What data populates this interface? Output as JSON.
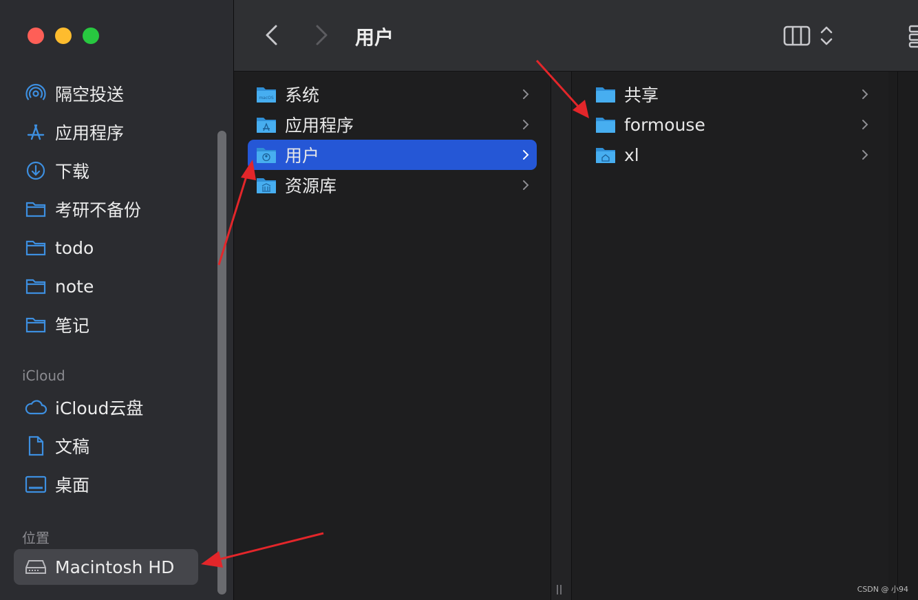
{
  "sidebar": {
    "favorites": [
      {
        "label": "隔空投送",
        "icon": "airdrop-icon"
      },
      {
        "label": "应用程序",
        "icon": "applications-icon"
      },
      {
        "label": "下载",
        "icon": "download-icon"
      },
      {
        "label": "考研不备份",
        "icon": "folder-icon"
      },
      {
        "label": "todo",
        "icon": "folder-icon"
      },
      {
        "label": "note",
        "icon": "folder-icon"
      },
      {
        "label": "笔记",
        "icon": "folder-icon"
      }
    ],
    "icloud_section": "iCloud",
    "icloud": [
      {
        "label": "iCloud云盘",
        "icon": "cloud-icon"
      },
      {
        "label": "文稿",
        "icon": "document-icon"
      },
      {
        "label": "桌面",
        "icon": "desktop-icon"
      }
    ],
    "locations_section": "位置",
    "locations": [
      {
        "label": "Macintosh HD",
        "icon": "hard-drive-icon",
        "selected": true
      }
    ]
  },
  "toolbar": {
    "title": "用户",
    "back_icon": "chevron-left-icon",
    "forward_icon": "chevron-right-icon",
    "view_icon": "column-view-icon",
    "sort_icon": "up-down-chevron-icon"
  },
  "columns": [
    {
      "items": [
        {
          "label": "系统",
          "icon": "system-folder-icon",
          "selected": false
        },
        {
          "label": "应用程序",
          "icon": "applications-folder-icon",
          "selected": false
        },
        {
          "label": "用户",
          "icon": "users-folder-icon",
          "selected": true
        },
        {
          "label": "资源库",
          "icon": "library-folder-icon",
          "selected": false
        }
      ]
    },
    {
      "items": [
        {
          "label": "共享",
          "icon": "folder-icon"
        },
        {
          "label": "formouse",
          "icon": "folder-icon"
        },
        {
          "label": "xl",
          "icon": "home-folder-icon"
        }
      ]
    }
  ],
  "watermark": "CSDN @ 小94",
  "colors": {
    "selection_blue": "#2557d6",
    "folder_blue": "#3fa8e8",
    "sidebar_icon_blue": "#3d8fe0",
    "annotation_red": "#e3262a"
  }
}
